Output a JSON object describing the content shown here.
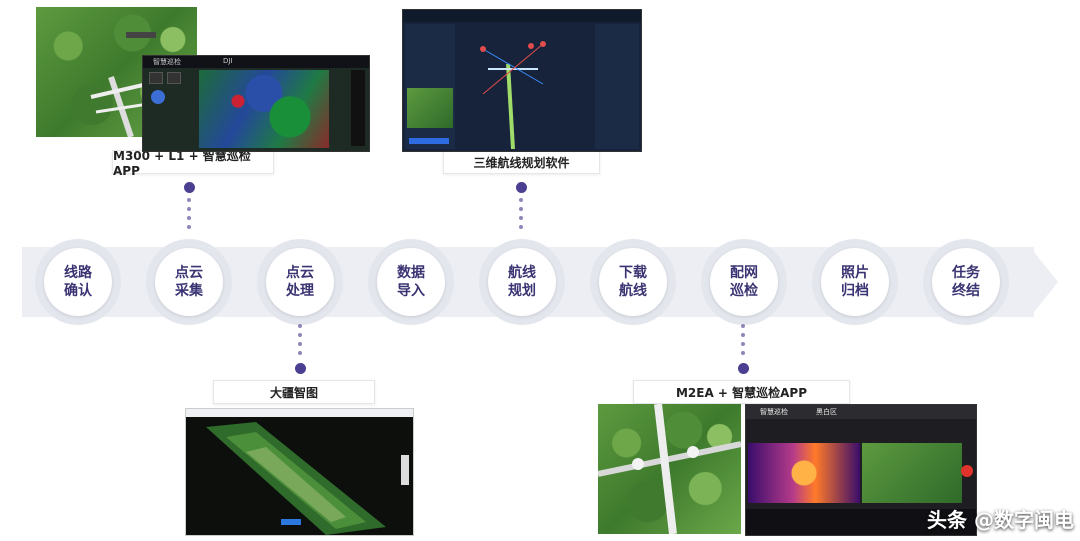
{
  "steps": [
    {
      "label": "线路\n确认"
    },
    {
      "label": "点云\n采集"
    },
    {
      "label": "点云\n处理"
    },
    {
      "label": "数据\n导入"
    },
    {
      "label": "航线\n规划"
    },
    {
      "label": "下载\n航线"
    },
    {
      "label": "配网\n巡检"
    },
    {
      "label": "照片\n归档"
    },
    {
      "label": "任务\n终结"
    }
  ],
  "captions": {
    "top_left": "M300 + L1 + 智慧巡检APP",
    "top_middle": "三维航线规划软件",
    "bottom_left": "大疆智图",
    "bottom_right": "M2EA + 智慧巡检APP"
  },
  "screens": {
    "app_title": "智慧巡检",
    "brand": "DJI",
    "bottom_right_tab1": "智慧巡检",
    "bottom_right_tab2": "黑白区"
  },
  "watermark": "头条 @数字闽电",
  "colors": {
    "accent": "#4a3f91",
    "node_text": "#3a3473",
    "band": "#eceef4"
  }
}
